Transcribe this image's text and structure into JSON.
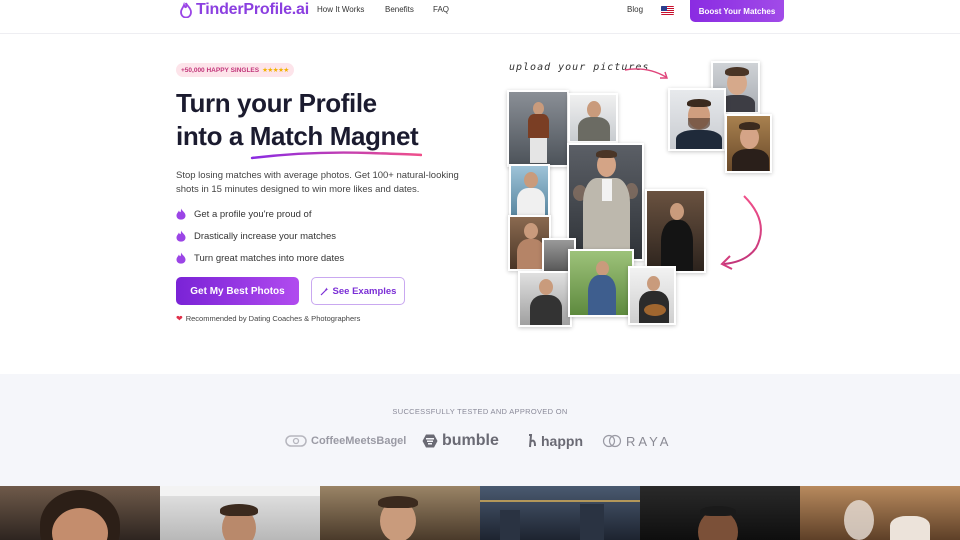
{
  "nav": {
    "logo_text": "TinderProfile.ai",
    "links": [
      "How It Works",
      "Benefits",
      "FAQ"
    ],
    "blog": "Blog",
    "cta": "Boost Your Matches"
  },
  "hero": {
    "badge_text": "+50,000 HAPPY SINGLES",
    "badge_stars": "★★★★★",
    "title_line1": "Turn your Profile",
    "title_line2": "into a Match Magnet",
    "subtitle": "Stop losing matches with average photos. Get 100+ natural-looking shots in 15 minutes designed to win more likes and dates.",
    "bullets": [
      "Get a profile you're proud of",
      "Drastically increase your matches",
      "Turn great matches into more dates"
    ],
    "primary_cta": "Get My Best Photos",
    "secondary_cta": "See Examples",
    "recommended": "Recommended by Dating Coaches & Photographers",
    "upload_note": "upload your pictures"
  },
  "partners": {
    "title": "SUCCESSFULLY TESTED AND APPROVED ON",
    "logos": [
      "CoffeeMeetsBagel",
      "bumble",
      "happn",
      "RAYA"
    ]
  },
  "colors": {
    "brand": "#8b3fe0",
    "cta_gradient_start": "#7a23d6",
    "cta_gradient_end": "#b14bef",
    "accent_pink": "#e0457b"
  },
  "icons": {
    "logo": "flame-icon",
    "bullet": "flame-icon",
    "see_examples": "magic-wand-icon",
    "recommended": "heart-icon",
    "flag": "us-flag-icon"
  }
}
